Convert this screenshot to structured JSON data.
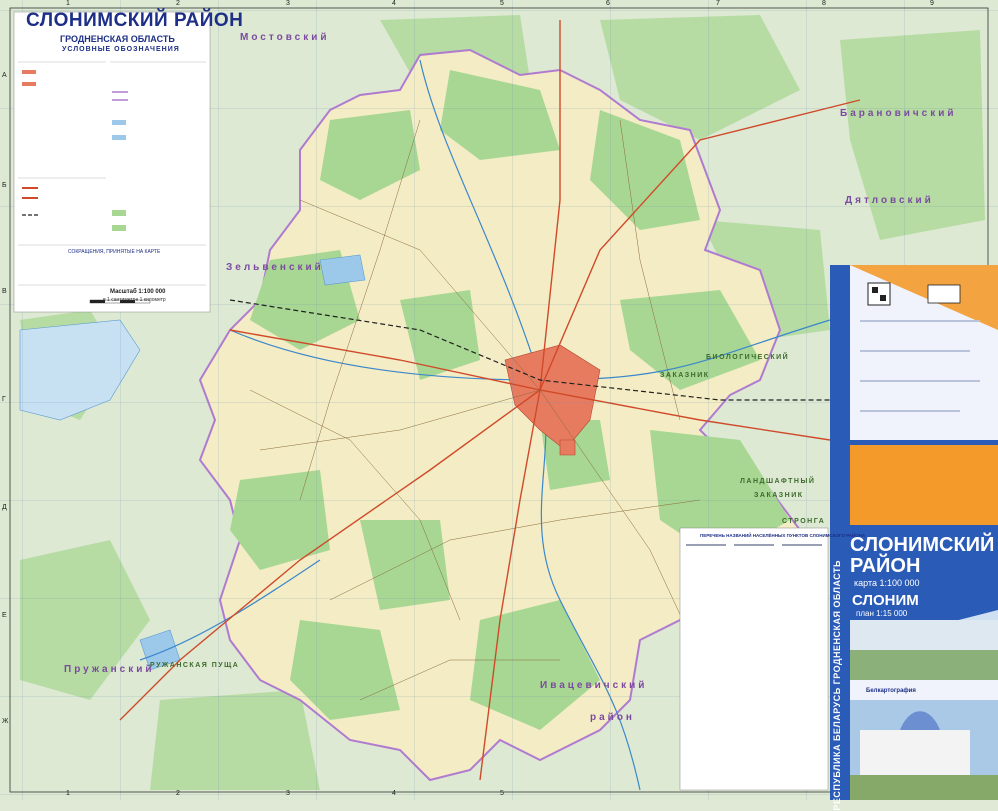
{
  "map": {
    "title": "СЛОНИМСКИЙ РАЙОН",
    "subtitle": "ГРОДНЕНСКАЯ ОБЛАСТЬ",
    "legend_title": "УСЛОВНЫЕ ОБОЗНАЧЕНИЯ",
    "abbr_title": "СОКРАЩЕНИЯ, ПРИНЯТЫЕ НА КАРТЕ",
    "scale": "Масштаб 1:100 000",
    "scale_sub": "в 1 сантиметре 1 километр",
    "grid_cols": [
      "1",
      "2",
      "3",
      "4",
      "5",
      "6",
      "7",
      "8",
      "9"
    ],
    "grid_rows": [
      "А",
      "Б",
      "В",
      "Г",
      "Д",
      "Е",
      "Ж"
    ],
    "neighbors": [
      {
        "name": "Мостовский",
        "id": "mostovsky"
      },
      {
        "name": "Барановичский",
        "id": "baranovichi"
      },
      {
        "name": "Дятловский",
        "id": "dyatlovo"
      },
      {
        "name": "Зельвенский",
        "id": "zelva"
      },
      {
        "name": "Ивацевичский",
        "id": "ivatsevichi"
      },
      {
        "name": "Пружанский",
        "id": "pruzhany"
      },
      {
        "name": "район",
        "id": "rayon"
      }
    ],
    "reserves": [
      "БИОЛОГИЧЕСКИЙ",
      "ЗАКАЗНИК",
      "ЛАНДШАФТНЫЙ",
      "ЗАКАЗНИК",
      "СТРОНГА",
      "РУЖАНСКАЯ ПУЩА"
    ],
    "index_title": "ПЕРЕЧЕНЬ НАЗВАНИЙ НАСЕЛЁННЫХ ПУНКТОВ СЛОНИМСКОГО РАЙОНА"
  },
  "cover": {
    "title": "СЛОНИМСКИЙ РАЙОН",
    "map_scale": "карта 1:100 000",
    "city": "СЛОНИМ",
    "plan_scale": "план 1:15 000",
    "vertical": "РЕСПУБЛИКА БЕЛАРУСЬ  ГРОДНЕНСКАЯ ОБЛАСТЬ",
    "publisher": "Белкартография"
  },
  "colors": {
    "field": "#f3ecc4",
    "forest": "#9fd08a",
    "forest_dark": "#6fb25f",
    "water": "#9cc9ea",
    "city": "#e77b5f",
    "road_main": "#d04a2a",
    "boundary": "#b07ad0",
    "outside": "#d9e7d0",
    "cover_blue": "#2a5bb6",
    "cover_orange": "#f39a2a"
  }
}
